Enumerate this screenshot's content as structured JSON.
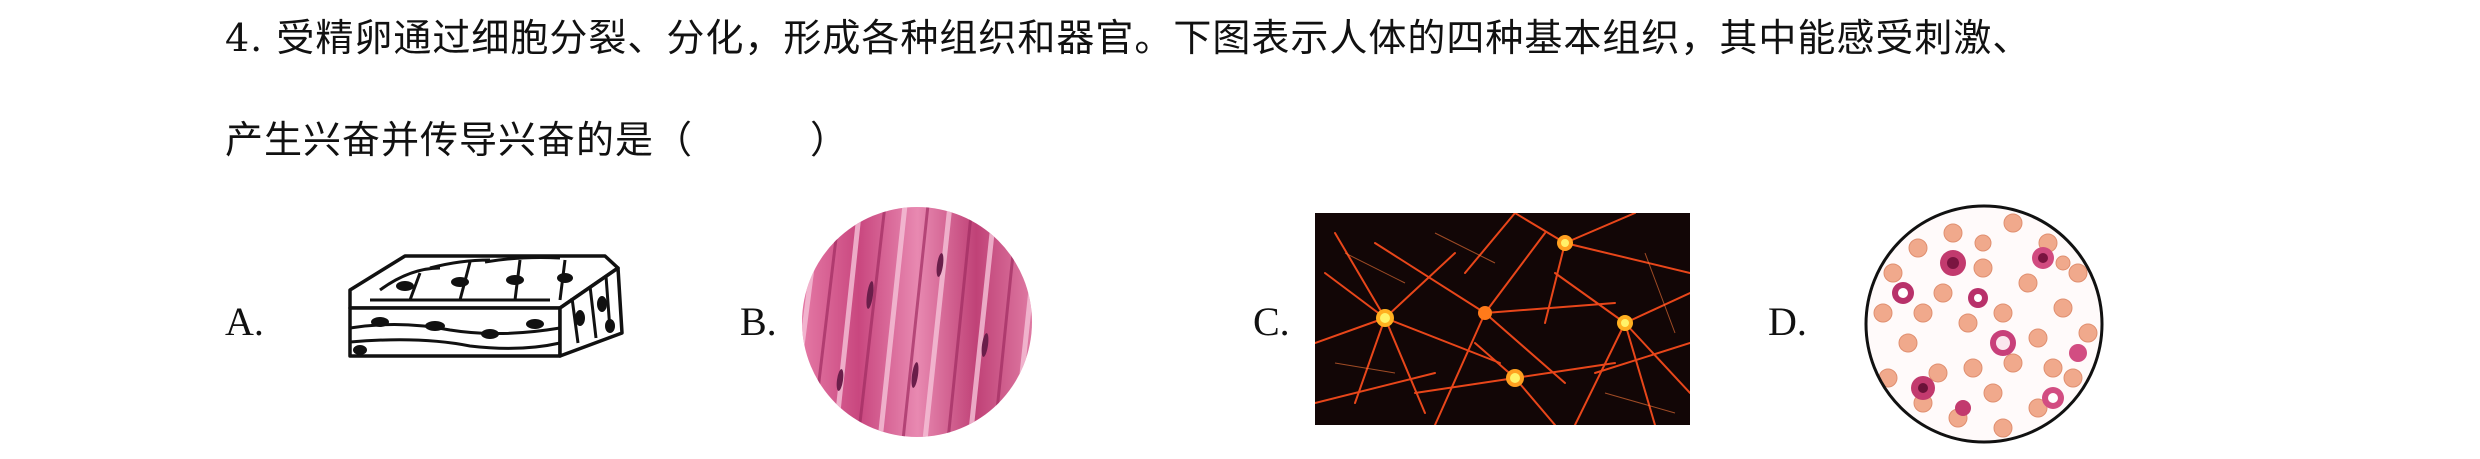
{
  "question": {
    "line1": "4. 受精卵通过细胞分裂、分化，形成各种组织和器官。下图表示人体的四种基本组织，其中能感受刺激、",
    "line2": "产生兴奋并传导兴奋的是（　　　）"
  },
  "options": [
    {
      "label": "A.",
      "figure": "epithelial-tissue-drawing"
    },
    {
      "label": "B.",
      "figure": "muscle-tissue-micrograph"
    },
    {
      "label": "C.",
      "figure": "nerve-tissue-micrograph"
    },
    {
      "label": "D.",
      "figure": "blood-smear-micrograph"
    }
  ],
  "colors": {
    "muscle_pink": "#d9578e",
    "neuron_orange": "#ff5a1a",
    "neuron_bg": "#120606",
    "rbc": "#f0a98c"
  }
}
